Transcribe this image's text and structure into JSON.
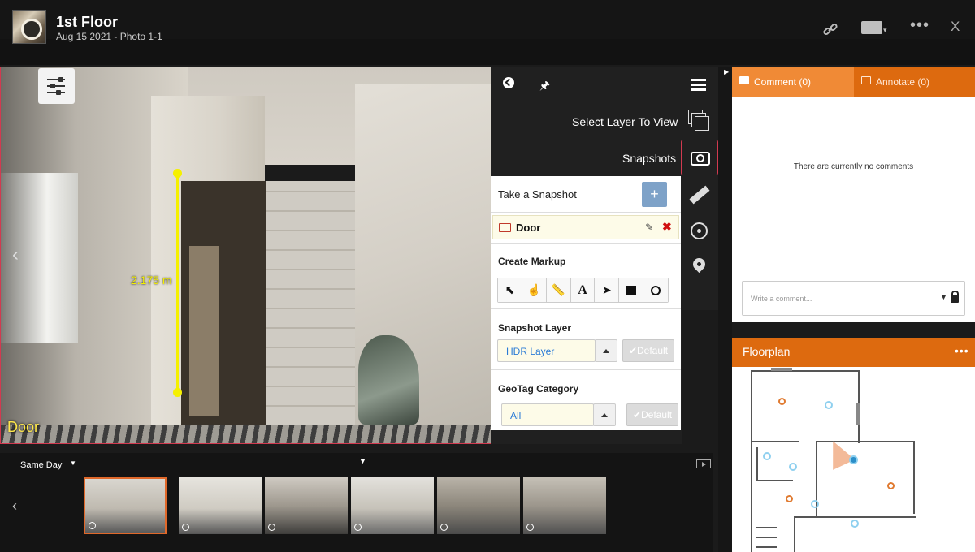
{
  "header": {
    "title": "1st Floor",
    "subtitle": "Aug 15 2021 - Photo 1-1"
  },
  "viewer": {
    "measurement": "2.175 m",
    "caption": "Door"
  },
  "panel": {
    "select_layer_label": "Select Layer To View",
    "snapshots_label": "Snapshots"
  },
  "snapshot_form": {
    "take_label": "Take a Snapshot",
    "add_label": "+",
    "snapshot_item": "Door",
    "markup_label": "Create Markup",
    "markup_text_tool": "A",
    "layer_label": "Snapshot Layer",
    "layer_value": "HDR Layer",
    "default_label": "✔Default",
    "geotag_label": "GeoTag Category",
    "geotag_value": "All"
  },
  "comments": {
    "tab_comment": "Comment (0)",
    "tab_annotate": "Annotate (0)",
    "empty_text": "There are currently no comments",
    "placeholder": "Write a comment..."
  },
  "floorplan": {
    "title": "Floorplan"
  },
  "filmstrip": {
    "filter": "Same Day"
  },
  "colors": {
    "accent_orange": "#dd6a0f",
    "tab_active": "#f08a36",
    "selection_red": "#d23a50",
    "measure_yellow": "#f5f000",
    "value_blue": "#2a7bd6"
  }
}
